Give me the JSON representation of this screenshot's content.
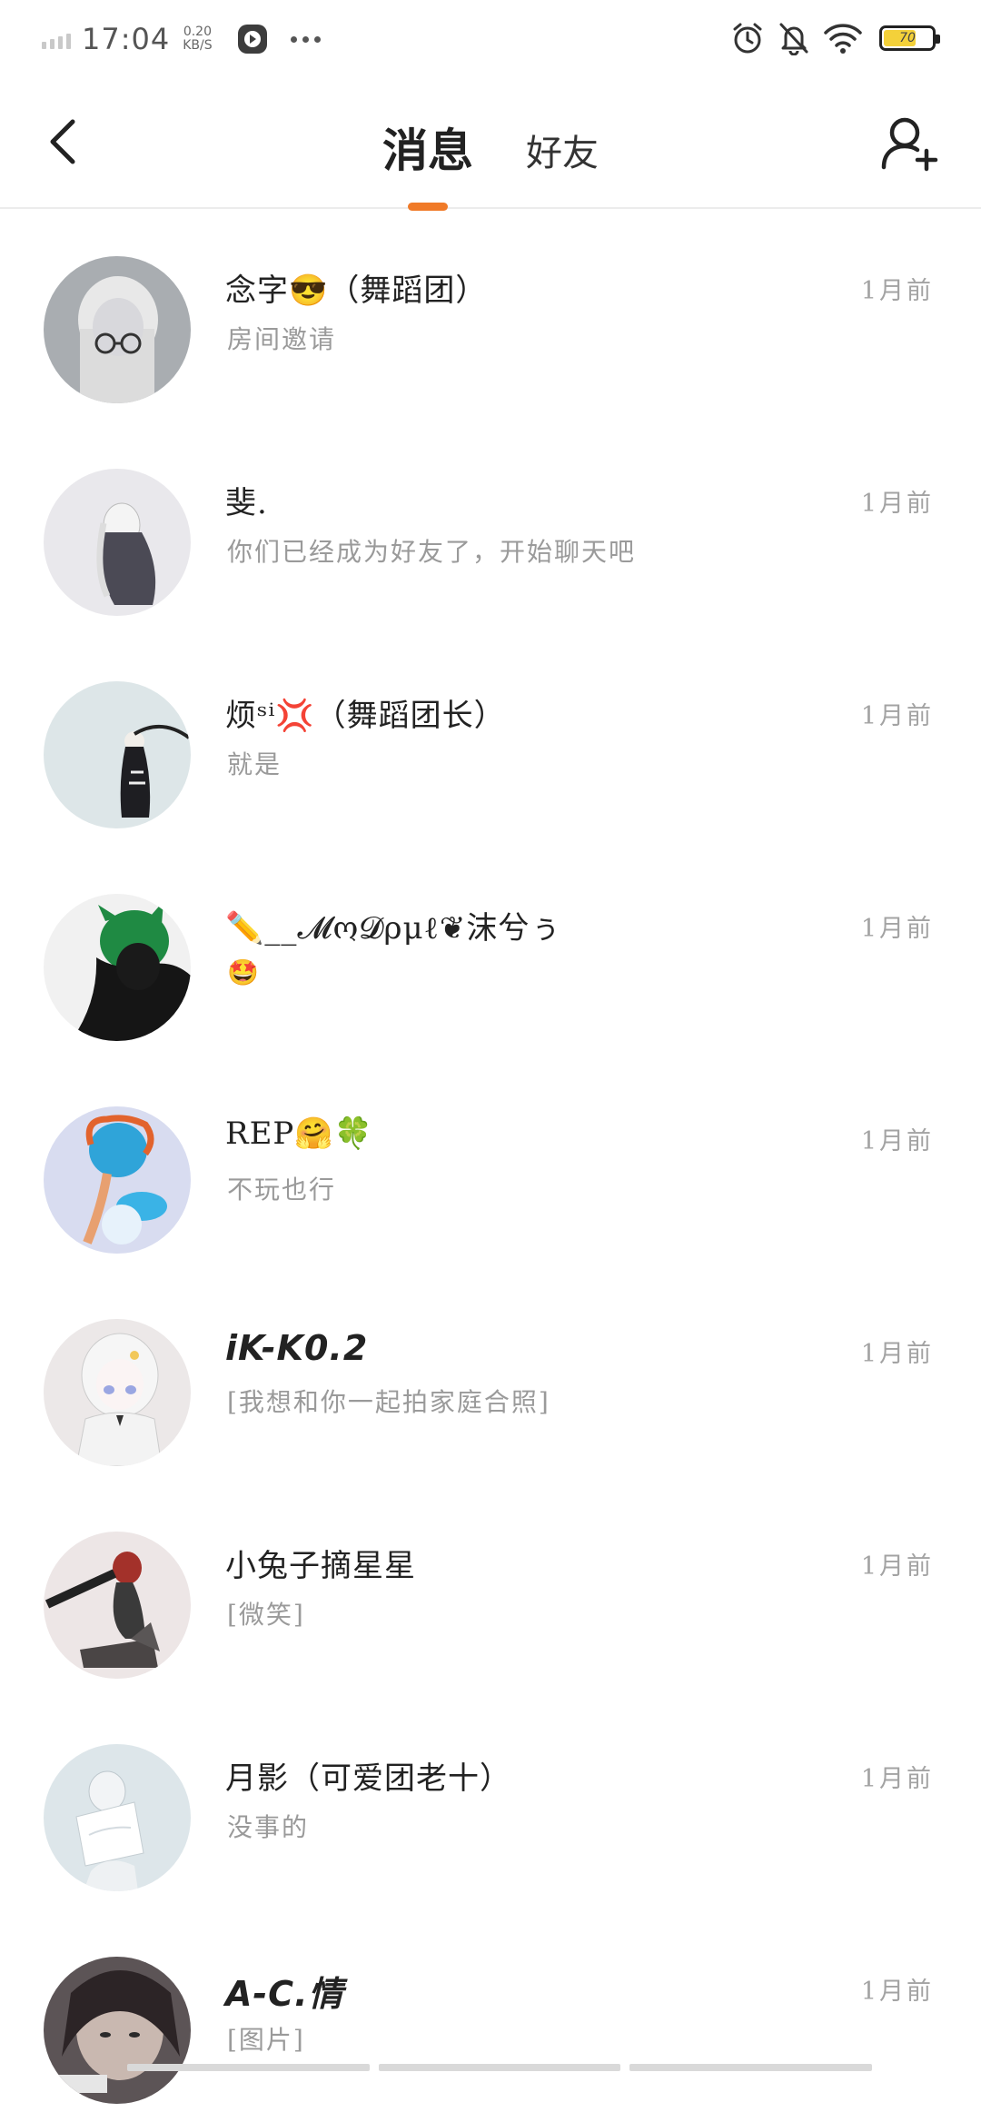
{
  "status_bar": {
    "time": "17:04",
    "net_speed_value": "0.20",
    "net_speed_unit": "KB/S",
    "battery_level": "70",
    "battery_fraction": 0.7,
    "icons": [
      "signal-icon",
      "play-icon",
      "more-dots-icon",
      "alarm-icon",
      "silent-bell-icon",
      "wifi-icon",
      "battery-icon"
    ]
  },
  "header": {
    "tabs": [
      {
        "label": "消息",
        "active": true
      },
      {
        "label": "好友",
        "active": false
      }
    ],
    "accent_color": "#f07a28",
    "back_icon": "back-chevron-icon",
    "add_friend_icon": "add-friend-icon"
  },
  "messages": [
    {
      "name": "念字😎（舞蹈团）",
      "preview": "房间邀请",
      "time": "1月前"
    },
    {
      "name": "斐.",
      "preview": "你们已经成为好友了，开始聊天吧",
      "time": "1月前"
    },
    {
      "name": "烦ˢⁱ💢（舞蹈团长）",
      "preview": "就是",
      "time": "1月前"
    },
    {
      "name": "✏️__𝓜ო𝓓ρμℓ❦沫兮ぅ",
      "preview": "🤩",
      "time": "1月前"
    },
    {
      "name": "REP🤗🍀",
      "preview": "不玩也行",
      "time": "1月前"
    },
    {
      "name": "iK-K0.2",
      "preview": "[我想和你一起拍家庭合照]",
      "time": "1月前"
    },
    {
      "name": "小兔子摘星星",
      "preview": "[微笑]",
      "time": "1月前"
    },
    {
      "name": "月影（可爱团老十）",
      "preview": "没事的",
      "time": "1月前"
    },
    {
      "name": "A-C.情",
      "preview": "[图片]",
      "time": "1月前"
    }
  ]
}
